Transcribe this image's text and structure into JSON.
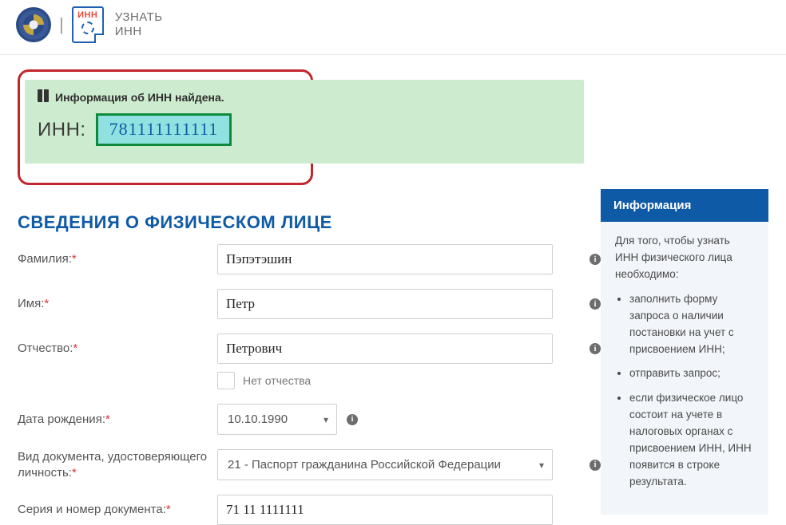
{
  "header": {
    "doc_badge": "ИНН",
    "title_line1": "УЗНАТЬ",
    "title_line2": "ИНН"
  },
  "result": {
    "found_text": "Информация об ИНН найдена.",
    "inn_label": "ИНН:",
    "inn_value": "781111111111"
  },
  "section_title": "СВЕДЕНИЯ О ФИЗИЧЕСКОМ ЛИЦЕ",
  "form": {
    "lastname_label": "Фамилия:",
    "lastname_value": "Пэпэтэшин",
    "firstname_label": "Имя:",
    "firstname_value": "Петр",
    "middlename_label": "Отчество:",
    "middlename_value": "Петрович",
    "no_middlename_label": "Нет отчества",
    "birthdate_label": "Дата рождения:",
    "birthdate_value": "10.10.1990",
    "doctype_label": "Вид документа, удостоверяющего личность:",
    "doctype_value": "21 - Паспорт гражданина Российской Федерации",
    "docnum_label": "Серия и номер документа:",
    "docnum_value": "71 11 1111111",
    "required_mark": "*"
  },
  "info_panel": {
    "title": "Информация",
    "intro": "Для того, чтобы узнать ИНН физического лица необходимо:",
    "bullets": [
      "заполнить форму запроса о наличии постановки на учет с присвоением ИНН;",
      "отправить запрос;",
      "если физическое лицо состоит на учете в налоговых органах с присвоением ИНН, ИНН появится в строке результата."
    ]
  }
}
